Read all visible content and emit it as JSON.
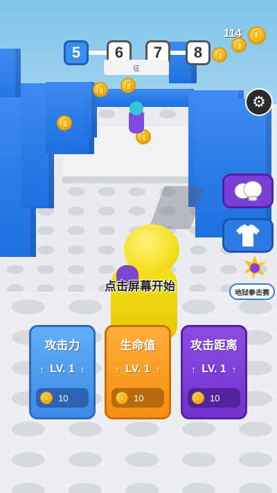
{
  "hud": {
    "levels": {
      "current": "5",
      "next": [
        "6",
        "7",
        "8"
      ]
    },
    "sub_label": "征",
    "coins": "114"
  },
  "settings": {
    "icon": "gear-icon"
  },
  "side_menu": {
    "gloves_icon": "boxing-gloves-icon",
    "shirt_icon": "shirt-icon",
    "hell_label": "地狱拳击赛"
  },
  "tap_hint": "点击屏幕开始",
  "upgrades": [
    {
      "title": "攻击力",
      "level": "LV. 1",
      "cost": "10",
      "color": "#3c8ae6"
    },
    {
      "title": "生命值",
      "level": "LV. 1",
      "cost": "10",
      "color": "#f58e10"
    },
    {
      "title": "攻击距离",
      "level": "LV. 1",
      "cost": "10",
      "color": "#7232cf"
    }
  ],
  "colors": {
    "wall": "#1f6fe0",
    "player": "#f3dc15",
    "coin": "#f5b415"
  }
}
